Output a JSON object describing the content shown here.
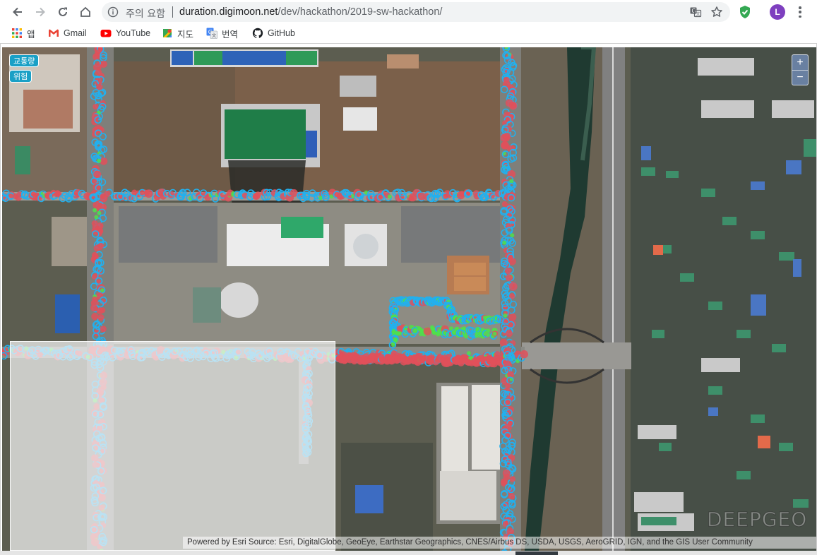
{
  "browser": {
    "security_warning": "주의 요함",
    "url_host": "duration.digimoon.net",
    "url_path": "/dev/hackathon/2019-sw-hackathon/",
    "profile_initial": "L",
    "icons": {
      "back": "arrow-left-icon",
      "forward": "arrow-right-icon",
      "reload": "reload-icon",
      "home": "home-icon",
      "info": "info-icon",
      "translate": "translate-icon",
      "star": "star-icon",
      "extension": "shield-check-icon",
      "menu": "more-vert-icon"
    },
    "colors": {
      "avatar": "#7e3fbf",
      "shield": "#34a853"
    }
  },
  "bookmarks": [
    {
      "label": "앱",
      "icon": "apps-grid-icon"
    },
    {
      "label": "Gmail",
      "icon": "gmail-icon"
    },
    {
      "label": "YouTube",
      "icon": "youtube-icon"
    },
    {
      "label": "지도",
      "icon": "maps-icon"
    },
    {
      "label": "번역",
      "icon": "translate-icon"
    },
    {
      "label": "GitHub",
      "icon": "github-icon"
    }
  ],
  "map": {
    "layers": [
      {
        "label": "교통량",
        "color": "#1aa0c6"
      },
      {
        "label": "위험",
        "color": "#1aa0c6"
      }
    ],
    "zoom_in_label": "+",
    "zoom_out_label": "−",
    "watermark": "DEEPGEO",
    "attribution": "Powered by Esri Source: Esri, DigitalGlobe, GeoEye, Earthstar Geographics, CNES/Airbus DS, USDA, USGS, AeroGRID, IGN, and the GIS User Community",
    "point_colors": {
      "traffic": "#22b0ee",
      "risk": "#e0505a",
      "safe": "#4fe04a"
    }
  }
}
